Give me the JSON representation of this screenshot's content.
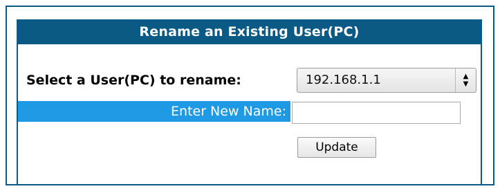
{
  "form": {
    "title": "Rename an Existing User(PC)",
    "select_label": "Select a User(PC) to rename:",
    "selected_user": "192.168.1.1",
    "new_name_label": "Enter New Name:",
    "new_name_value": "",
    "update_label": "Update"
  },
  "colors": {
    "header_bg": "#0b5a86",
    "label_bar_bg": "#1e9ae5",
    "header_text": "#ffffff"
  }
}
